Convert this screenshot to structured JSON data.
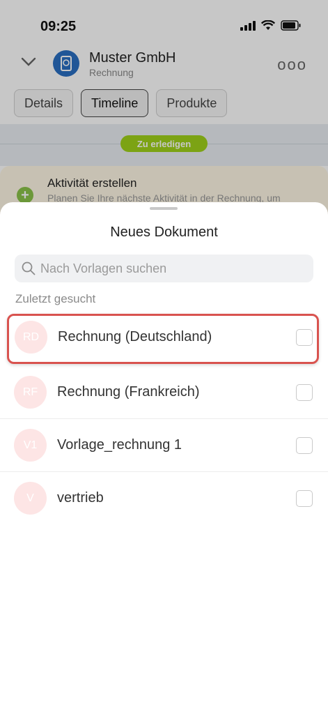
{
  "status_bar": {
    "time": "09:25"
  },
  "header": {
    "company": "Muster GmbH",
    "subtitle": "Rechnung",
    "more": "ooo"
  },
  "tabs": [
    {
      "label": "Details"
    },
    {
      "label": "Timeline"
    },
    {
      "label": "Produkte"
    }
  ],
  "timeline": {
    "badge": "Zu erledigen"
  },
  "activity": {
    "title": "Aktivität erstellen",
    "description": "Planen Sie Ihre nächste Aktivität in der Rechnung, um"
  },
  "sheet": {
    "title": "Neues Dokument",
    "search_placeholder": "Nach Vorlagen suchen",
    "section_label": "Zuletzt gesucht",
    "items": [
      {
        "initials": "RD",
        "label": "Rechnung (Deutschland)",
        "checked": false
      },
      {
        "initials": "RF",
        "label": "Rechnung (Frankreich)",
        "checked": false
      },
      {
        "initials": "V1",
        "label": "Vorlage_rechnung 1",
        "checked": false
      },
      {
        "initials": "V",
        "label": "vertrieb",
        "checked": false
      }
    ]
  },
  "colors": {
    "badge": "#9fd11a",
    "highlight": "#d9534f",
    "avatar_bg": "#fde5e5"
  }
}
